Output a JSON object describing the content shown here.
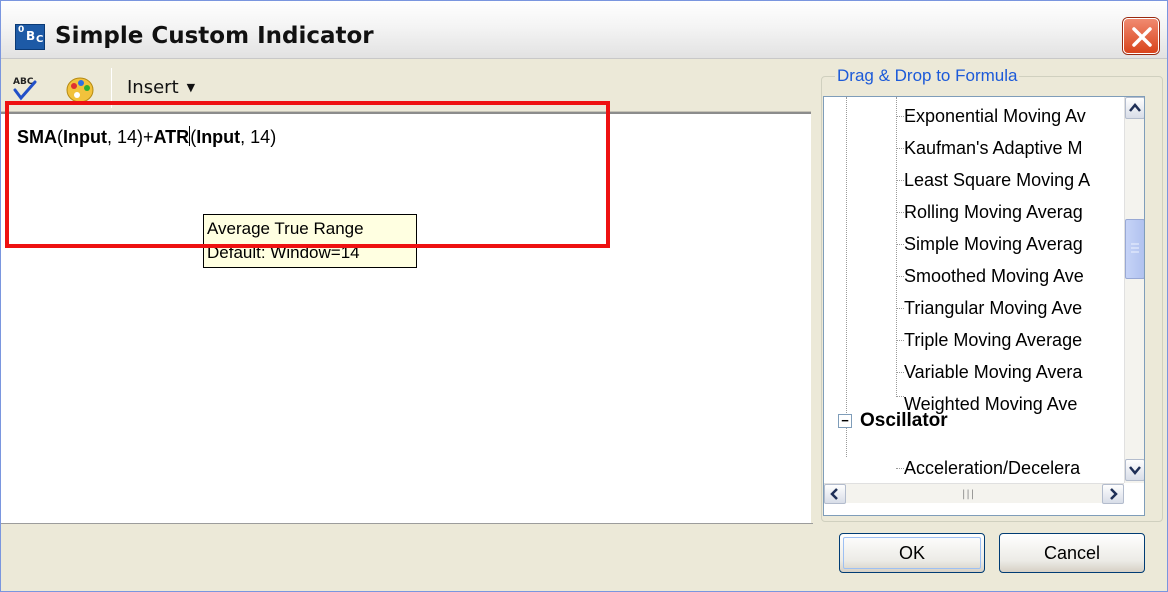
{
  "window": {
    "title": "Simple Custom Indicator"
  },
  "toolbar": {
    "insert_label": "Insert"
  },
  "editor": {
    "code_parts": [
      "SMA",
      "(",
      "Input",
      ", 14)+",
      "ATR",
      "(",
      "Input",
      ", 14)"
    ],
    "tooltip_line1": "Average True Range",
    "tooltip_line2": "Default: Window=14"
  },
  "panel": {
    "group_label": "Drag & Drop to Formula",
    "items": [
      "Exponential Moving Av",
      "Kaufman's Adaptive M",
      "Least Square Moving A",
      "Rolling Moving Averag",
      "Simple Moving Averag",
      "Smoothed Moving Ave",
      "Triangular Moving Ave",
      "Triple Moving Average",
      "Variable Moving Avera",
      "Weighted Moving Ave"
    ],
    "category": "Oscillator",
    "sub_item": "Acceleration/Decelera"
  },
  "buttons": {
    "ok": "OK",
    "cancel": "Cancel"
  },
  "colors": {
    "highlight": "#ee1111",
    "link": "#1c5ad9",
    "tooltip_bg": "#ffffe1"
  },
  "icons": [
    "app-icon",
    "close-icon",
    "spell-check-icon",
    "palette-icon",
    "dropdown-caret-icon",
    "tree-collapse-icon",
    "scroll-up-icon",
    "scroll-down-icon",
    "scroll-left-icon",
    "scroll-right-icon"
  ]
}
